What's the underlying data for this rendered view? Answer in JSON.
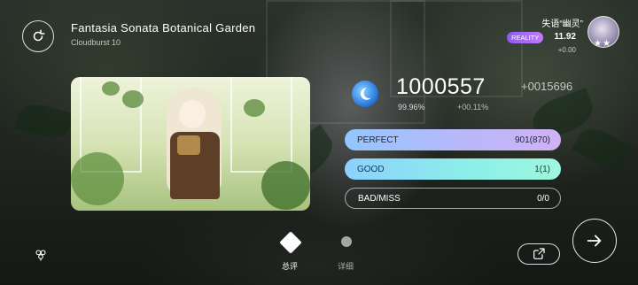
{
  "header": {
    "song_title": "Fantasia Sonata Botanical Garden",
    "song_level": "Cloudburst 10",
    "retry_icon": "retry-icon"
  },
  "player": {
    "name": "失语“幽灵”",
    "badge": "REALITY",
    "rks": "11.92",
    "rks_delta": "+0.00",
    "stars": "★★"
  },
  "result": {
    "score": "1000557",
    "score_delta": "+0015696",
    "accuracy": "99.96%",
    "accuracy_delta": "+00.11%",
    "judges": [
      {
        "label": "PERFECT",
        "value": "901(870)"
      },
      {
        "label": "GOOD",
        "value": "1(1)"
      },
      {
        "label": "BAD/MISS",
        "value": "0/0"
      }
    ]
  },
  "tabs": {
    "summary_label": "总评",
    "detail_label": "详细"
  },
  "colors": {
    "perfect_bar": "#b9b8fb",
    "good_bar": "#8cf0e8",
    "badge": "#a66cf2"
  }
}
